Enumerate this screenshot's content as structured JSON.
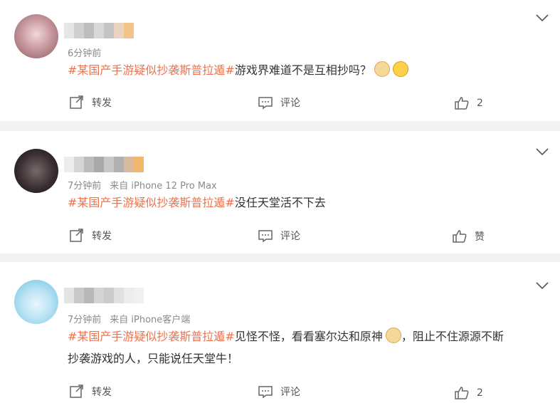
{
  "posts": [
    {
      "meta": [
        "6分钟前"
      ],
      "hashtag": "#某国产手游疑似抄袭斯普拉遁#",
      "text": "游戏界难道不是互相抄吗？",
      "emojis": [
        "doge-emoji",
        "thinking-emoji"
      ],
      "actions": {
        "repost": "转发",
        "comment": "评论",
        "like": "2"
      }
    },
    {
      "meta": [
        "7分钟前",
        "来自 iPhone 12 Pro Max"
      ],
      "hashtag": "#某国产手游疑似抄袭斯普拉遁#",
      "text": "没任天堂活不下去",
      "actions": {
        "repost": "转发",
        "comment": "评论",
        "like": "赞"
      }
    },
    {
      "meta": [
        "7分钟前",
        "来自 iPhone客户端"
      ],
      "hashtag": "#某国产手游疑似抄袭斯普拉遁#",
      "text1": "见怪不怪，看看塞尔达和原神",
      "text2": "，阻止不住源源不断",
      "text3": "抄袭游戏的人，只能说任天堂牛！",
      "actions": {
        "repost": "转发",
        "comment": "评论",
        "like": "2"
      }
    }
  ],
  "colors": {
    "hashtag": "#eb7350",
    "meta": "#8a8a8a",
    "page_bg": "#f2f2f2"
  }
}
